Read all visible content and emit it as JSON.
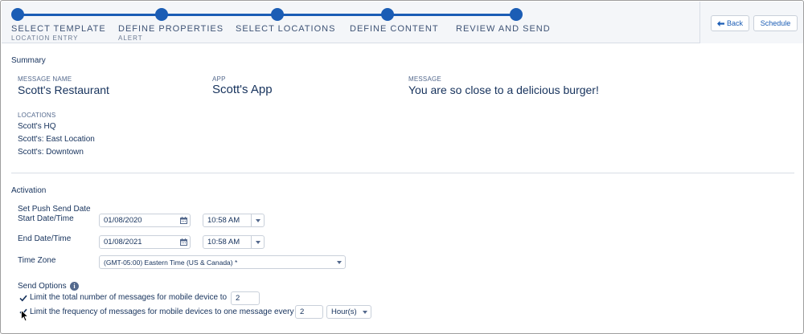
{
  "wizard": {
    "steps": [
      {
        "label": "SELECT TEMPLATE",
        "sublabel": "LOCATION ENTRY"
      },
      {
        "label": "DEFINE PROPERTIES",
        "sublabel": "ALERT"
      },
      {
        "label": "SELECT LOCATIONS",
        "sublabel": ""
      },
      {
        "label": "DEFINE CONTENT",
        "sublabel": ""
      },
      {
        "label": "REVIEW AND SEND",
        "sublabel": ""
      }
    ],
    "back_label": "Back",
    "schedule_label": "Schedule",
    "accent": "#1b5db5"
  },
  "summary": {
    "title": "Summary",
    "message_name_label": "MESSAGE NAME",
    "message_name": "Scott's Restaurant",
    "app_label": "APP",
    "app": "Scott's App",
    "message_label": "MESSAGE",
    "message": "You are so close to a delicious burger!",
    "locations_label": "LOCATIONS",
    "locations": [
      "Scott's HQ",
      "Scott's: East Location",
      "Scott's: Downtown"
    ]
  },
  "activation": {
    "title": "Activation",
    "push_send_label": "Set Push Send Date",
    "start_label": "Start Date/Time",
    "start_date": "01/08/2020",
    "start_time": "10:58 AM",
    "end_label": "End Date/Time",
    "end_date": "01/08/2021",
    "end_time": "10:58 AM",
    "timezone_label": "Time Zone",
    "timezone": "(GMT-05:00) Eastern Time (US & Canada) *",
    "send_options_label": "Send Options",
    "option1_label": "Limit the total number of messages for mobile device to",
    "option1_checked": true,
    "option1_value": "2",
    "option2_label": "Limit the frequency of messages for mobile devices to one message every",
    "option2_checked": true,
    "option2_value": "2",
    "option2_unit": "Hour(s)"
  }
}
